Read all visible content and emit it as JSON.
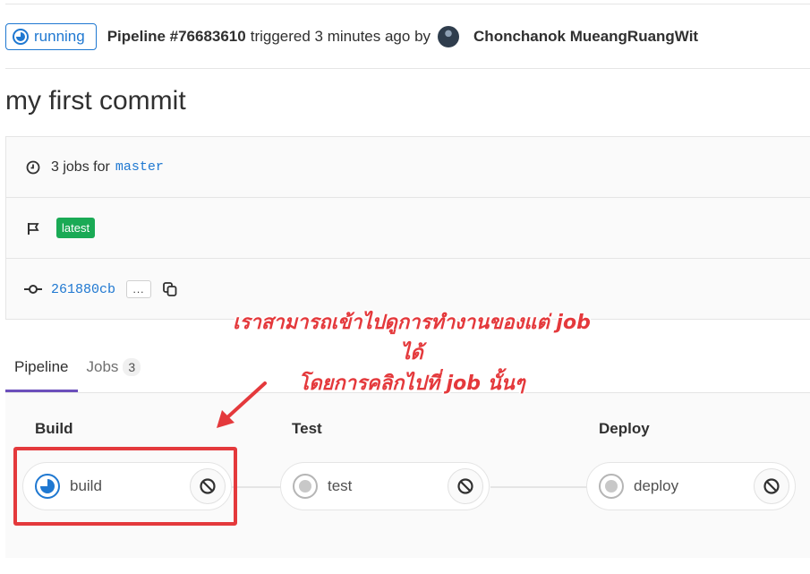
{
  "header": {
    "status": "running",
    "pipeline_id": "Pipeline #76683610",
    "triggered_text": "triggered 3 minutes ago by",
    "author": "Chonchanok MueangRuangWit"
  },
  "commit_title": "my first commit",
  "info": {
    "jobs_text": "3 jobs for",
    "branch": "master",
    "tag": "latest",
    "commit_sha": "261880cb",
    "more_label": "..."
  },
  "tabs": [
    {
      "label": "Pipeline",
      "active": true
    },
    {
      "label": "Jobs",
      "count": "3",
      "active": false
    }
  ],
  "stages": [
    {
      "title": "Build",
      "job": "build",
      "status": "running"
    },
    {
      "title": "Test",
      "job": "test",
      "status": "created"
    },
    {
      "title": "Deploy",
      "job": "deploy",
      "status": "created"
    }
  ],
  "annotation": {
    "line1": "เราสามารถเข้าไปดูการทำงานของแต่ job ได้",
    "line2": "โดยการคลิกไปที่ job นั้นๆ"
  },
  "colors": {
    "running": "#1f78d1",
    "success_badge": "#1aaa55",
    "annotation": "#e4393c",
    "active_tab": "#6b4fbb"
  },
  "icons": [
    "running-status-icon",
    "clock-icon",
    "flag-icon",
    "commit-icon",
    "copy-icon",
    "cancel-icon",
    "created-status-icon"
  ]
}
